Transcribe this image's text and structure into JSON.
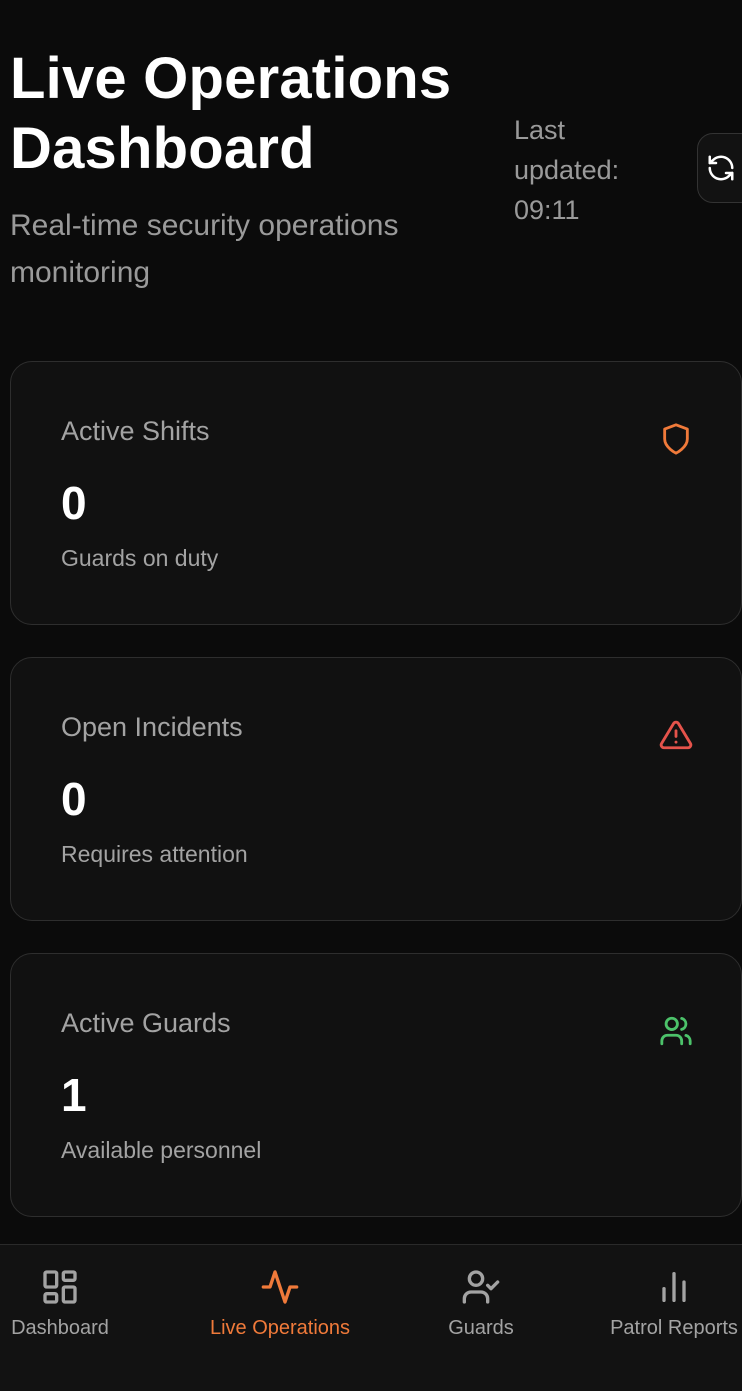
{
  "header": {
    "title": "Live Operations Dashboard",
    "subtitle": "Real-time security operations monitoring",
    "last_updated": "Last updated: 09:11",
    "refresh_icon": "refresh-icon"
  },
  "stats": [
    {
      "label": "Active Shifts",
      "value": "0",
      "description": "Guards on duty",
      "icon": "shield-icon",
      "icon_color": "#f07a3a"
    },
    {
      "label": "Open Incidents",
      "value": "0",
      "description": "Requires attention",
      "icon": "alert-triangle-icon",
      "icon_color": "#e5534b"
    },
    {
      "label": "Active Guards",
      "value": "1",
      "description": "Available personnel",
      "icon": "users-icon",
      "icon_color": "#4cc26a"
    }
  ],
  "nav": {
    "items": [
      {
        "label": "Dashboard",
        "icon": "grid-icon",
        "active": false
      },
      {
        "label": "Live Operations",
        "icon": "activity-icon",
        "active": true
      },
      {
        "label": "Guards",
        "icon": "user-check-icon",
        "active": false
      },
      {
        "label": "Patrol Reports",
        "icon": "bar-chart-icon",
        "active": false
      }
    ],
    "active_color": "#f07a3a"
  }
}
